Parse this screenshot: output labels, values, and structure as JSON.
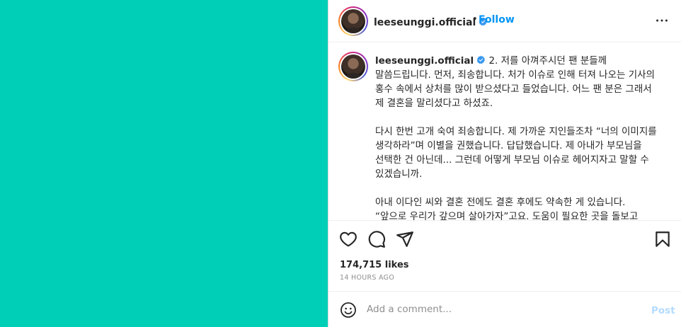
{
  "post": {
    "media_color": "#00CFB7"
  },
  "header": {
    "username": "leeseunggi.official",
    "separator": "•",
    "follow_label": "Follow",
    "more_icon": "more-horizontal-icon"
  },
  "caption": {
    "username": "leeseunggi.official",
    "paragraphs": [
      "2. 저를 아껴주시던 팬 분들께 말씀드립니다. 먼저, 죄송합니다. 처가 이슈로 인해 터져 나오는 기사의 홍수 속에서 상처를 많이 받으셨다고 들었습니다. 어느 팬 분은 그래서 제 결혼을 말리셨다고 하셨죠.",
      "다시 한번 고개 숙여 죄송합니다. 제 가까운 지인들조차 “너의 이미지를 생각하라”며 이별을 권했습니다. 답답했습니다. 제 아내가 부모님을 선택한 건 아닌데... 그런데 어떻게 부모님 이슈로 헤어지자고 말할 수 있겠습니까.",
      "아내 이다인 씨와 결혼 전에도 결혼 후에도 약속한 게 있습니다. “앞으로 우리가 갚으며 살아가자”고요. 도움이 필요한 곳을 돌보고 더욱 아픈 곳을 살피겠습니다. 이 결심은 ‘악플’과 상관없이 지"
    ]
  },
  "actions": {
    "like_icon": "heart-icon",
    "comment_icon": "comment-icon",
    "share_icon": "share-icon",
    "save_icon": "bookmark-icon"
  },
  "stats": {
    "likes": "174,715 likes",
    "timestamp": "14 HOURS AGO"
  },
  "comment": {
    "placeholder": "Add a comment...",
    "post_label": "Post",
    "emoji_icon": "emoji-icon"
  },
  "colors": {
    "accent": "#0095f6",
    "post_disabled": "#b3dbff",
    "verified": "#3897f0",
    "muted": "#8e8e8e"
  }
}
